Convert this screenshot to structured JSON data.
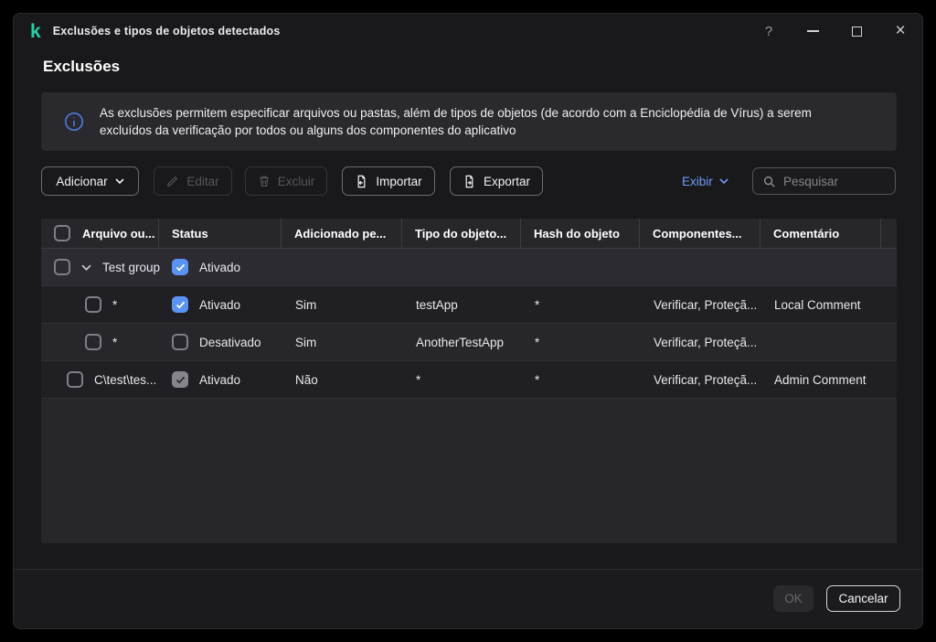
{
  "colors": {
    "brand_teal": "#23d1a8",
    "accent_blue": "#5b93f5",
    "link_blue": "#6f9cf8",
    "info_icon_blue": "#4a79d8"
  },
  "icons": {
    "logo": "kaspersky-k",
    "info": "info-circle",
    "edit": "pencil",
    "delete": "trash",
    "import": "file-arrow-in",
    "export": "file-arrow-out",
    "search": "magnifier",
    "expander": "chevron-down",
    "dropdown": "chevron-down"
  },
  "window": {
    "logo_glyph": "k",
    "title": "Exclusões e tipos de objetos detectados",
    "controls": {
      "help": "?",
      "close": "×"
    }
  },
  "page": {
    "heading": "Exclusões",
    "info_text": "As exclusões permitem especificar arquivos ou pastas, além de tipos de objetos (de acordo com a Enciclopédia de Vírus) a serem excluídos da verificação por todos ou alguns dos componentes do aplicativo"
  },
  "toolbar": {
    "add_label": "Adicionar",
    "edit_label": "Editar",
    "delete_label": "Excluir",
    "import_label": "Importar",
    "export_label": "Exportar",
    "view_label": "Exibir",
    "search_placeholder": "Pesquisar"
  },
  "table": {
    "headers": [
      "Arquivo ou...",
      "Status",
      "Adicionado pe...",
      "Tipo do objeto...",
      "Hash do objeto",
      "Componentes...",
      "Comentário"
    ],
    "rows": [
      {
        "kind": "group",
        "name": "Test group",
        "status_label": "Ativado",
        "status_checked": true
      },
      {
        "kind": "child",
        "file": "*",
        "status_label": "Ativado",
        "status_checked": true,
        "added_by": "Sim",
        "object_type": "testApp",
        "hash": "*",
        "components": "Verificar, Proteçã...",
        "comment": "Local Comment"
      },
      {
        "kind": "child",
        "file": "*",
        "status_label": "Desativado",
        "status_checked": false,
        "added_by": "Sim",
        "object_type": "AnotherTestApp",
        "hash": "*",
        "components": "Verificar, Proteçã...",
        "comment": ""
      },
      {
        "kind": "item",
        "file": "C\\test\\tes...",
        "status_label": "Ativado",
        "status_checked": true,
        "status_disabled": true,
        "added_by": "Não",
        "object_type": "*",
        "hash": "*",
        "components": "Verificar, Proteçã...",
        "comment": "Admin Comment"
      }
    ]
  },
  "footer": {
    "ok_label": "OK",
    "cancel_label": "Cancelar"
  }
}
